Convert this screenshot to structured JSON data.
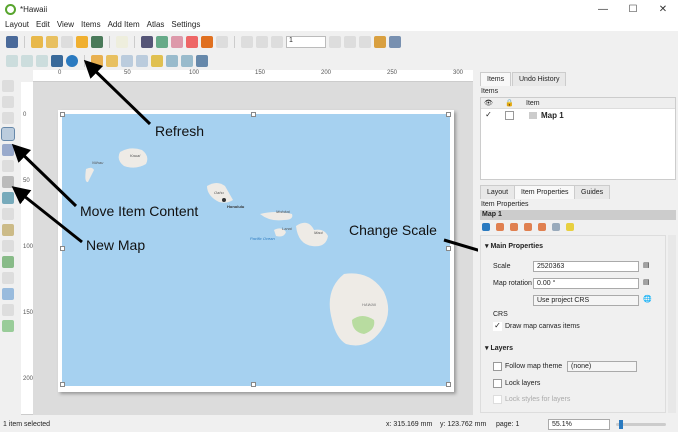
{
  "window": {
    "title": "*Hawaii",
    "min": "—",
    "max": "☐",
    "close": "✕"
  },
  "menu": [
    "Layout",
    "Edit",
    "View",
    "Items",
    "Add Item",
    "Atlas",
    "Settings"
  ],
  "toolbar": {
    "page_value": "1"
  },
  "ruler_top": [
    "0",
    "50",
    "100",
    "150",
    "200",
    "250",
    "300"
  ],
  "ruler_left": [
    "0",
    "50",
    "100",
    "150",
    "200"
  ],
  "map": {
    "labels": [
      "Kauai",
      "Niihau",
      "Oahu",
      "Honolulu",
      "Molokai",
      "Lanai",
      "Maui",
      "Pacific Ocean",
      "HAWAII"
    ],
    "colors": {
      "ocean": "#a6d1f0",
      "land": "#eeebe6",
      "park": "#b8dca0"
    }
  },
  "annotations": {
    "refresh": "Refresh",
    "move_item_content": "Move Item Content",
    "new_map": "New Map",
    "change_scale": "Change Scale"
  },
  "panel": {
    "top_tabs": [
      "Items",
      "Undo History"
    ],
    "items_title": "Items",
    "items_header": "Item",
    "items": [
      {
        "visible": true,
        "locked": false,
        "name": "Map 1"
      }
    ],
    "bottom_tabs": [
      "Layout",
      "Item Properties",
      "Guides"
    ],
    "props_title": "Item Properties",
    "item_name": "Map 1",
    "main_properties": "Main Properties",
    "scale_label": "Scale",
    "scale_value": "2520363",
    "rotation_label": "Map rotation",
    "rotation_value": "0.00 °",
    "crs_value": "Use project CRS",
    "crs_label": "CRS",
    "draw_canvas_items": "Draw map canvas items",
    "layers": "Layers",
    "follow_theme": "Follow map theme",
    "theme_value": "(none)",
    "lock_layers": "Lock layers",
    "lock_styles": "Lock styles for layers"
  },
  "status": {
    "message": "1 item selected",
    "x": "x: 315.169 mm",
    "y": "y: 123.762 mm",
    "page": "page: 1",
    "zoom": "55.1%",
    "zoom_slider": 0.1
  }
}
